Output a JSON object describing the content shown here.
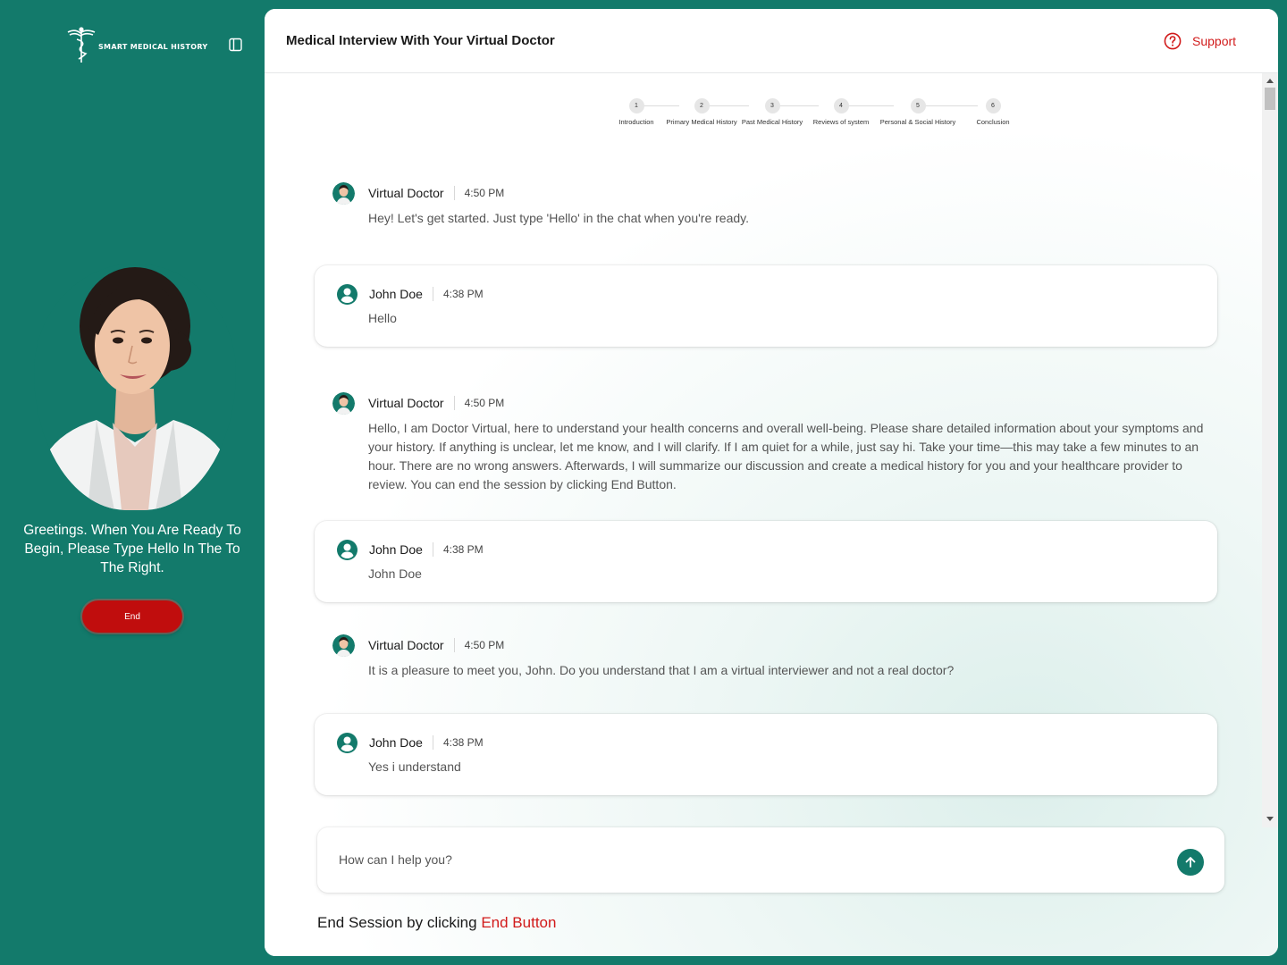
{
  "sidebar": {
    "logo_text": "SMART MEDICAL HISTORY",
    "greeting": "Greetings. When You Are Ready To Begin, Please Type Hello In The To The Right.",
    "end_button": "End"
  },
  "header": {
    "title": "Medical Interview With Your Virtual Doctor",
    "support": "Support"
  },
  "stepper": [
    {
      "num": "1",
      "label": "Introduction"
    },
    {
      "num": "2",
      "label": "Primary Medical History"
    },
    {
      "num": "3",
      "label": "Past Medical History"
    },
    {
      "num": "4",
      "label": "Reviews of system"
    },
    {
      "num": "5",
      "label": "Personal & Social History"
    },
    {
      "num": "6",
      "label": "Conclusion"
    }
  ],
  "messages": [
    {
      "sender": "Virtual Doctor",
      "time": "4:50 PM",
      "text": "Hey! Let's get started. Just type 'Hello' in the chat when you're ready."
    },
    {
      "sender": "John Doe",
      "time": "4:38 PM",
      "text": "Hello"
    },
    {
      "sender": "Virtual Doctor",
      "time": "4:50 PM",
      "text": "Hello, I am Doctor Virtual, here to understand your health concerns and overall well-being. Please share detailed information about your symptoms and your history. If anything is unclear, let me know, and I will clarify. If I am quiet for a while, just say hi. Take your time—this may take a few minutes to an hour. There are no wrong answers. Afterwards, I will summarize our discussion and create a medical history for you and your healthcare provider to review. You can end the session by clicking End Button."
    },
    {
      "sender": "John Doe",
      "time": "4:38 PM",
      "text": "John Doe"
    },
    {
      "sender": "Virtual Doctor",
      "time": "4:50 PM",
      "text": "It is a pleasure to meet you, John. Do you understand that I am a virtual interviewer and not a real doctor?"
    },
    {
      "sender": "John Doe",
      "time": "4:38 PM",
      "text": "Yes i understand"
    }
  ],
  "input": {
    "placeholder": "How can I help you?"
  },
  "footer": {
    "note_prefix": "End Session by clicking ",
    "note_highlight": "End Button"
  },
  "colors": {
    "brand": "#137a6b",
    "danger": "#c00d0d",
    "support": "#d11a1a"
  }
}
